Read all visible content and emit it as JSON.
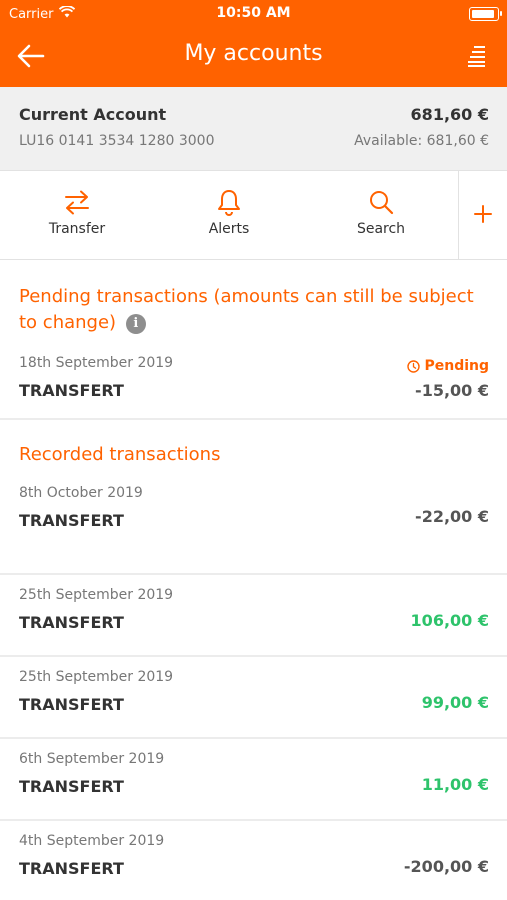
{
  "status_bar": {
    "carrier": "Carrier",
    "time": "10:50 AM"
  },
  "nav": {
    "title": "My accounts",
    "back_icon": "arrow-left-icon",
    "menu_icon": "menu-icon"
  },
  "account": {
    "name": "Current Account",
    "iban": "LU16 0141 3534 1280 3000",
    "balance": "681,60 €",
    "available": "Available: 681,60 €"
  },
  "actions": [
    {
      "label": "Transfer",
      "icon": "transfer-arrows-icon"
    },
    {
      "label": "Alerts",
      "icon": "bell-icon"
    },
    {
      "label": "Search",
      "icon": "search-icon"
    },
    {
      "label": "",
      "icon": "plus-icon"
    }
  ],
  "pending": {
    "title": "Pending transactions (amounts can still be subject to change)",
    "info_icon_text": "i",
    "transactions": [
      {
        "date": "18th September 2019",
        "label": "TRANSFERT",
        "amount": "-15,00 €",
        "status": "Pending"
      }
    ]
  },
  "recorded": {
    "title": "Recorded transactions",
    "transactions": [
      {
        "date": "8th October 2019",
        "label": "TRANSFERT",
        "amount": "-22,00 €",
        "positive": false
      },
      {
        "date": "25th September 2019",
        "label": "TRANSFERT",
        "amount": "106,00 €",
        "positive": true
      },
      {
        "date": "25th September 2019",
        "label": "TRANSFERT",
        "amount": "99,00 €",
        "positive": true
      },
      {
        "date": "6th September 2019",
        "label": "TRANSFERT",
        "amount": "11,00 €",
        "positive": true
      },
      {
        "date": "4th September 2019",
        "label": "TRANSFERT",
        "amount": "-200,00 €",
        "positive": false
      }
    ]
  },
  "colors": {
    "brand_orange": "#ff6200",
    "positive_green": "#2ec36b",
    "muted_text": "#777777"
  }
}
